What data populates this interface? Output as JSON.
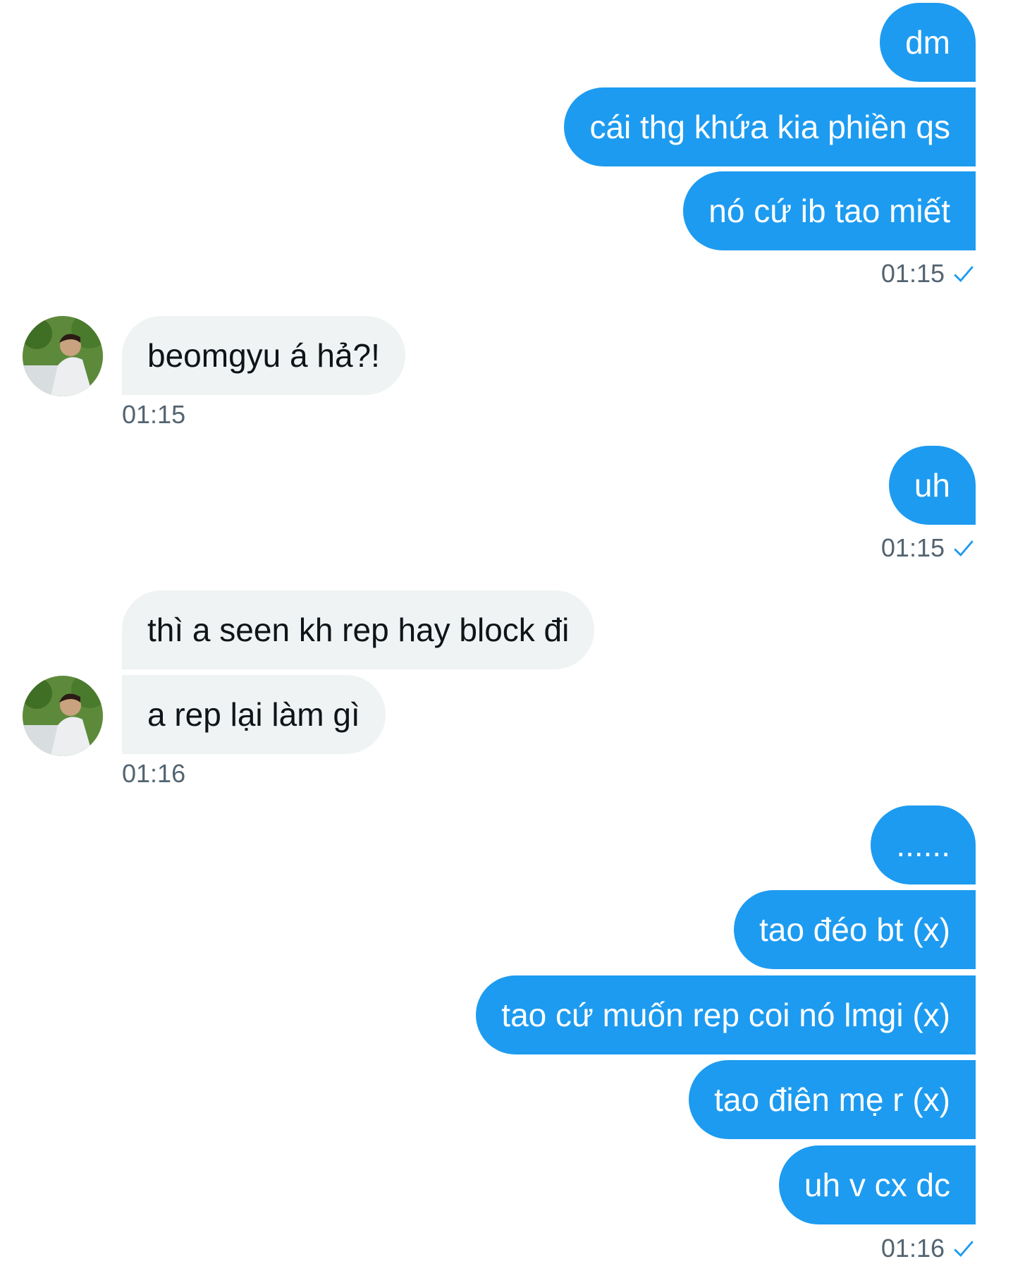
{
  "conversation": {
    "groups": [
      {
        "sender": "me",
        "messages": [
          "dm",
          "cái thg khứa kia phiền qs",
          "nó cứ ib tao miết"
        ],
        "time": "01:15",
        "seen_icon": "check-icon"
      },
      {
        "sender": "them",
        "messages": [
          "beomgyu á hả?!"
        ],
        "time": "01:15"
      },
      {
        "sender": "me",
        "messages": [
          "uh"
        ],
        "time": "01:15",
        "seen_icon": "check-icon"
      },
      {
        "sender": "them",
        "messages": [
          "thì a seen kh rep hay block đi",
          "a rep lại làm gì"
        ],
        "time": "01:16"
      },
      {
        "sender": "me",
        "messages": [
          "......",
          "tao đéo bt (x)",
          "tao cứ muốn rep coi nó lmgi (x)",
          "tao điên mẹ r (x)",
          "uh v cx dc"
        ],
        "time": "01:16",
        "seen_icon": "check-icon"
      }
    ]
  },
  "colors": {
    "outgoing_bubble": "#1d9bf0",
    "incoming_bubble": "#eff3f4",
    "timestamp": "#536471",
    "check": "#1d9bf0"
  }
}
